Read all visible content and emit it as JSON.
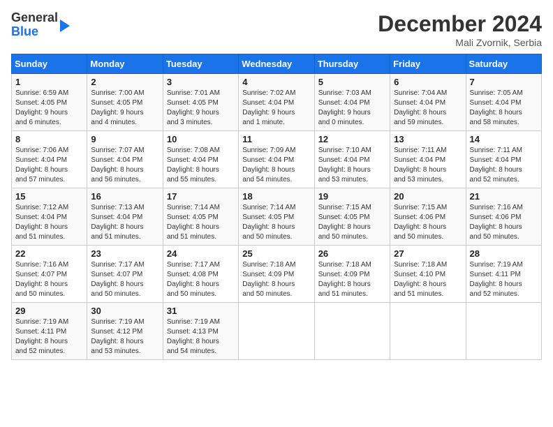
{
  "header": {
    "logo_line1": "General",
    "logo_line2": "Blue",
    "month": "December 2024",
    "location": "Mali Zvornik, Serbia"
  },
  "days_of_week": [
    "Sunday",
    "Monday",
    "Tuesday",
    "Wednesday",
    "Thursday",
    "Friday",
    "Saturday"
  ],
  "weeks": [
    [
      {
        "day": "1",
        "info": "Sunrise: 6:59 AM\nSunset: 4:05 PM\nDaylight: 9 hours\nand 6 minutes."
      },
      {
        "day": "2",
        "info": "Sunrise: 7:00 AM\nSunset: 4:05 PM\nDaylight: 9 hours\nand 4 minutes."
      },
      {
        "day": "3",
        "info": "Sunrise: 7:01 AM\nSunset: 4:05 PM\nDaylight: 9 hours\nand 3 minutes."
      },
      {
        "day": "4",
        "info": "Sunrise: 7:02 AM\nSunset: 4:04 PM\nDaylight: 9 hours\nand 1 minute."
      },
      {
        "day": "5",
        "info": "Sunrise: 7:03 AM\nSunset: 4:04 PM\nDaylight: 9 hours\nand 0 minutes."
      },
      {
        "day": "6",
        "info": "Sunrise: 7:04 AM\nSunset: 4:04 PM\nDaylight: 8 hours\nand 59 minutes."
      },
      {
        "day": "7",
        "info": "Sunrise: 7:05 AM\nSunset: 4:04 PM\nDaylight: 8 hours\nand 58 minutes."
      }
    ],
    [
      {
        "day": "8",
        "info": "Sunrise: 7:06 AM\nSunset: 4:04 PM\nDaylight: 8 hours\nand 57 minutes."
      },
      {
        "day": "9",
        "info": "Sunrise: 7:07 AM\nSunset: 4:04 PM\nDaylight: 8 hours\nand 56 minutes."
      },
      {
        "day": "10",
        "info": "Sunrise: 7:08 AM\nSunset: 4:04 PM\nDaylight: 8 hours\nand 55 minutes."
      },
      {
        "day": "11",
        "info": "Sunrise: 7:09 AM\nSunset: 4:04 PM\nDaylight: 8 hours\nand 54 minutes."
      },
      {
        "day": "12",
        "info": "Sunrise: 7:10 AM\nSunset: 4:04 PM\nDaylight: 8 hours\nand 53 minutes."
      },
      {
        "day": "13",
        "info": "Sunrise: 7:11 AM\nSunset: 4:04 PM\nDaylight: 8 hours\nand 53 minutes."
      },
      {
        "day": "14",
        "info": "Sunrise: 7:11 AM\nSunset: 4:04 PM\nDaylight: 8 hours\nand 52 minutes."
      }
    ],
    [
      {
        "day": "15",
        "info": "Sunrise: 7:12 AM\nSunset: 4:04 PM\nDaylight: 8 hours\nand 51 minutes."
      },
      {
        "day": "16",
        "info": "Sunrise: 7:13 AM\nSunset: 4:04 PM\nDaylight: 8 hours\nand 51 minutes."
      },
      {
        "day": "17",
        "info": "Sunrise: 7:14 AM\nSunset: 4:05 PM\nDaylight: 8 hours\nand 51 minutes."
      },
      {
        "day": "18",
        "info": "Sunrise: 7:14 AM\nSunset: 4:05 PM\nDaylight: 8 hours\nand 50 minutes."
      },
      {
        "day": "19",
        "info": "Sunrise: 7:15 AM\nSunset: 4:05 PM\nDaylight: 8 hours\nand 50 minutes."
      },
      {
        "day": "20",
        "info": "Sunrise: 7:15 AM\nSunset: 4:06 PM\nDaylight: 8 hours\nand 50 minutes."
      },
      {
        "day": "21",
        "info": "Sunrise: 7:16 AM\nSunset: 4:06 PM\nDaylight: 8 hours\nand 50 minutes."
      }
    ],
    [
      {
        "day": "22",
        "info": "Sunrise: 7:16 AM\nSunset: 4:07 PM\nDaylight: 8 hours\nand 50 minutes."
      },
      {
        "day": "23",
        "info": "Sunrise: 7:17 AM\nSunset: 4:07 PM\nDaylight: 8 hours\nand 50 minutes."
      },
      {
        "day": "24",
        "info": "Sunrise: 7:17 AM\nSunset: 4:08 PM\nDaylight: 8 hours\nand 50 minutes."
      },
      {
        "day": "25",
        "info": "Sunrise: 7:18 AM\nSunset: 4:09 PM\nDaylight: 8 hours\nand 50 minutes."
      },
      {
        "day": "26",
        "info": "Sunrise: 7:18 AM\nSunset: 4:09 PM\nDaylight: 8 hours\nand 51 minutes."
      },
      {
        "day": "27",
        "info": "Sunrise: 7:18 AM\nSunset: 4:10 PM\nDaylight: 8 hours\nand 51 minutes."
      },
      {
        "day": "28",
        "info": "Sunrise: 7:19 AM\nSunset: 4:11 PM\nDaylight: 8 hours\nand 52 minutes."
      }
    ],
    [
      {
        "day": "29",
        "info": "Sunrise: 7:19 AM\nSunset: 4:11 PM\nDaylight: 8 hours\nand 52 minutes."
      },
      {
        "day": "30",
        "info": "Sunrise: 7:19 AM\nSunset: 4:12 PM\nDaylight: 8 hours\nand 53 minutes."
      },
      {
        "day": "31",
        "info": "Sunrise: 7:19 AM\nSunset: 4:13 PM\nDaylight: 8 hours\nand 54 minutes."
      },
      null,
      null,
      null,
      null
    ]
  ]
}
